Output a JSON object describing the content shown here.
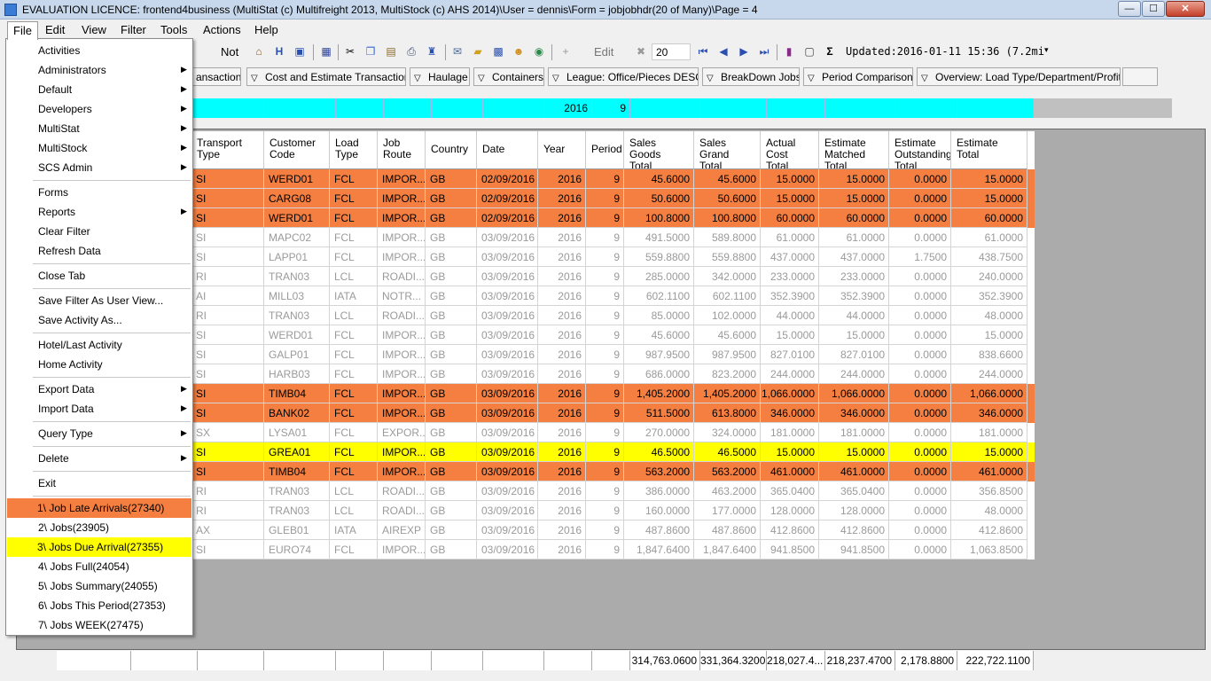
{
  "window": {
    "title": "EVALUATION LICENCE: frontend4business (MultiStat (c) Multifreight 2013, MultiStock (c) AHS 2014)\\User = dennis\\Form = jobjobhdr(20 of Many)\\Page = 4",
    "min": "—",
    "max": "☐",
    "close": "✕"
  },
  "menubar": [
    "File",
    "Edit",
    "View",
    "Filter",
    "Tools",
    "Actions",
    "Help"
  ],
  "toolbar": {
    "not_label": "Not",
    "h_label": "H",
    "edit_label": "Edit",
    "count_value": "20",
    "updated": "Updated:2016-01-11 15:36 (7.2mi",
    "dropdown": "▾",
    "icons": [
      "home-icon",
      "h-icon",
      "book-icon",
      "grid-icon",
      "cut-icon",
      "copy-icon",
      "paste-icon",
      "print-icon",
      "mail-icon",
      "folder-icon",
      "save-icon",
      "face-icon",
      "globe-icon",
      "add-icon",
      "delete-icon",
      "first-icon",
      "prev-icon",
      "next-icon",
      "last-icon",
      "chart-icon",
      "report-icon",
      "sigma-icon"
    ]
  },
  "tabs": [
    "ansactions",
    "Cost and Estimate Transactions",
    "Haulage",
    "Containers",
    "League: Office/Pieces DESC",
    "BreakDown Jobs",
    "Period Comparisons",
    "Overview: Load Type/Department/Profit..."
  ],
  "filter_row": {
    "year": "2016",
    "period": "9"
  },
  "columns": [
    "Transport\nType",
    "Customer\nCode",
    "Load\nType",
    "Job\nRoute",
    "Country",
    "Date",
    "Year",
    "Period",
    "Sales\nGoods\nTotal",
    "Sales\nGrand\nTotal",
    "Actual\nCost\nTotal",
    "Estimate\nMatched\nTotal",
    "Estimate\nOutstanding\nTotal",
    "Estimate\nTotal"
  ],
  "rows": [
    {
      "style": "orange",
      "cells": [
        "SI",
        "WERD01",
        "FCL",
        "IMPOR...",
        "GB",
        "02/09/2016",
        "2016",
        "9",
        "45.6000",
        "45.6000",
        "15.0000",
        "15.0000",
        "0.0000",
        "15.0000"
      ]
    },
    {
      "style": "orange",
      "cells": [
        "SI",
        "CARG08",
        "FCL",
        "IMPOR...",
        "GB",
        "02/09/2016",
        "2016",
        "9",
        "50.6000",
        "50.6000",
        "15.0000",
        "15.0000",
        "0.0000",
        "15.0000"
      ]
    },
    {
      "style": "orange",
      "cells": [
        "SI",
        "WERD01",
        "FCL",
        "IMPOR...",
        "GB",
        "02/09/2016",
        "2016",
        "9",
        "100.8000",
        "100.8000",
        "60.0000",
        "60.0000",
        "0.0000",
        "60.0000"
      ]
    },
    {
      "style": "plain",
      "cells": [
        "SI",
        "MAPC02",
        "FCL",
        "IMPOR...",
        "GB",
        "03/09/2016",
        "2016",
        "9",
        "491.5000",
        "589.8000",
        "61.0000",
        "61.0000",
        "0.0000",
        "61.0000"
      ]
    },
    {
      "style": "plain",
      "cells": [
        "SI",
        "LAPP01",
        "FCL",
        "IMPOR...",
        "GB",
        "03/09/2016",
        "2016",
        "9",
        "559.8800",
        "559.8800",
        "437.0000",
        "437.0000",
        "1.7500",
        "438.7500"
      ]
    },
    {
      "style": "plain",
      "cells": [
        "RI",
        "TRAN03",
        "LCL",
        "ROADI...",
        "GB",
        "03/09/2016",
        "2016",
        "9",
        "285.0000",
        "342.0000",
        "233.0000",
        "233.0000",
        "0.0000",
        "240.0000"
      ]
    },
    {
      "style": "plain",
      "cells": [
        "AI",
        "MILL03",
        "IATA",
        "NOTR...",
        "GB",
        "03/09/2016",
        "2016",
        "9",
        "602.1100",
        "602.1100",
        "352.3900",
        "352.3900",
        "0.0000",
        "352.3900"
      ]
    },
    {
      "style": "plain",
      "cells": [
        "RI",
        "TRAN03",
        "LCL",
        "ROADI...",
        "GB",
        "03/09/2016",
        "2016",
        "9",
        "85.0000",
        "102.0000",
        "44.0000",
        "44.0000",
        "0.0000",
        "48.0000"
      ]
    },
    {
      "style": "plain",
      "cells": [
        "SI",
        "WERD01",
        "FCL",
        "IMPOR...",
        "GB",
        "03/09/2016",
        "2016",
        "9",
        "45.6000",
        "45.6000",
        "15.0000",
        "15.0000",
        "0.0000",
        "15.0000"
      ]
    },
    {
      "style": "plain",
      "cells": [
        "SI",
        "GALP01",
        "FCL",
        "IMPOR...",
        "GB",
        "03/09/2016",
        "2016",
        "9",
        "987.9500",
        "987.9500",
        "827.0100",
        "827.0100",
        "0.0000",
        "838.6600"
      ]
    },
    {
      "style": "plain",
      "cells": [
        "SI",
        "HARB03",
        "FCL",
        "IMPOR...",
        "GB",
        "03/09/2016",
        "2016",
        "9",
        "686.0000",
        "823.2000",
        "244.0000",
        "244.0000",
        "0.0000",
        "244.0000"
      ]
    },
    {
      "style": "orange",
      "cells": [
        "SI",
        "TIMB04",
        "FCL",
        "IMPOR...",
        "GB",
        "03/09/2016",
        "2016",
        "9",
        "1,405.2000",
        "1,405.2000",
        "1,066.0000",
        "1,066.0000",
        "0.0000",
        "1,066.0000"
      ]
    },
    {
      "style": "orange",
      "cells": [
        "SI",
        "BANK02",
        "FCL",
        "IMPOR...",
        "GB",
        "03/09/2016",
        "2016",
        "9",
        "511.5000",
        "613.8000",
        "346.0000",
        "346.0000",
        "0.0000",
        "346.0000"
      ]
    },
    {
      "style": "plain",
      "cells": [
        "SX",
        "LYSA01",
        "FCL",
        "EXPOR...",
        "GB",
        "03/09/2016",
        "2016",
        "9",
        "270.0000",
        "324.0000",
        "181.0000",
        "181.0000",
        "0.0000",
        "181.0000"
      ]
    },
    {
      "style": "yellow",
      "cells": [
        "SI",
        "GREA01",
        "FCL",
        "IMPOR...",
        "GB",
        "03/09/2016",
        "2016",
        "9",
        "46.5000",
        "46.5000",
        "15.0000",
        "15.0000",
        "0.0000",
        "15.0000"
      ]
    },
    {
      "style": "orange",
      "cells": [
        "SI",
        "TIMB04",
        "FCL",
        "IMPOR...",
        "GB",
        "03/09/2016",
        "2016",
        "9",
        "563.2000",
        "563.2000",
        "461.0000",
        "461.0000",
        "0.0000",
        "461.0000"
      ]
    },
    {
      "style": "plain",
      "cells": [
        "RI",
        "TRAN03",
        "LCL",
        "ROADI...",
        "GB",
        "03/09/2016",
        "2016",
        "9",
        "386.0000",
        "463.2000",
        "365.0400",
        "365.0400",
        "0.0000",
        "356.8500"
      ]
    },
    {
      "style": "plain",
      "cells": [
        "RI",
        "TRAN03",
        "LCL",
        "ROADI...",
        "GB",
        "03/09/2016",
        "2016",
        "9",
        "160.0000",
        "177.0000",
        "128.0000",
        "128.0000",
        "0.0000",
        "48.0000"
      ]
    },
    {
      "style": "plain",
      "cells": [
        "AX",
        "GLEB01",
        "IATA",
        "AIREXP",
        "GB",
        "03/09/2016",
        "2016",
        "9",
        "487.8600",
        "487.8600",
        "412.8600",
        "412.8600",
        "0.0000",
        "412.8600"
      ]
    },
    {
      "style": "plain",
      "cells": [
        "SI",
        "EURO74",
        "FCL",
        "IMPOR...",
        "GB",
        "03/09/2016",
        "2016",
        "9",
        "1,847.6400",
        "1,847.6400",
        "941.8500",
        "941.8500",
        "0.0000",
        "1,063.8500"
      ]
    }
  ],
  "totals": [
    "314,763.0600",
    "331,364.3200",
    "218,027.4...",
    "218,237.4700",
    "2,178.8800",
    "222,722.1100"
  ],
  "file_menu": [
    {
      "label": "Activities"
    },
    {
      "label": "Administrators",
      "sub": true
    },
    {
      "label": "Default",
      "sub": true
    },
    {
      "label": "Developers",
      "sub": true
    },
    {
      "label": "MultiStat",
      "sub": true
    },
    {
      "label": "MultiStock",
      "sub": true
    },
    {
      "label": "SCS Admin",
      "sub": true
    },
    {
      "sep": true
    },
    {
      "label": "Forms"
    },
    {
      "label": "Reports",
      "sub": true
    },
    {
      "label": "Clear Filter"
    },
    {
      "label": "Refresh Data"
    },
    {
      "sep": true
    },
    {
      "label": "Close Tab"
    },
    {
      "sep": true
    },
    {
      "label": "Save Filter As User View..."
    },
    {
      "label": "Save Activity As..."
    },
    {
      "sep": true
    },
    {
      "label": "Hotel/Last Activity"
    },
    {
      "label": "Home Activity"
    },
    {
      "sep": true
    },
    {
      "label": "Export Data",
      "sub": true
    },
    {
      "label": "Import Data",
      "sub": true
    },
    {
      "sep": true
    },
    {
      "label": "Query Type",
      "sub": true
    },
    {
      "sep": true
    },
    {
      "label": "Delete",
      "sub": true
    },
    {
      "sep": true
    },
    {
      "label": "Exit"
    },
    {
      "sep": true
    },
    {
      "label": "1\\ Job Late Arrivals(27340)",
      "hl": "orange"
    },
    {
      "label": "2\\ Jobs(23905)"
    },
    {
      "label": "3\\ Jobs Due Arrival(27355)",
      "hl": "yellow"
    },
    {
      "label": "4\\ Jobs Full(24054)"
    },
    {
      "label": "5\\ Jobs Summary(24055)"
    },
    {
      "label": "6\\ Jobs This Period(27353)"
    },
    {
      "label": "7\\ Jobs WEEK(27475)"
    }
  ],
  "submenu_arrow": "▶",
  "colors": {
    "orange": "#f47f40",
    "yellow": "#ffff00",
    "cyan": "#00ffff"
  }
}
